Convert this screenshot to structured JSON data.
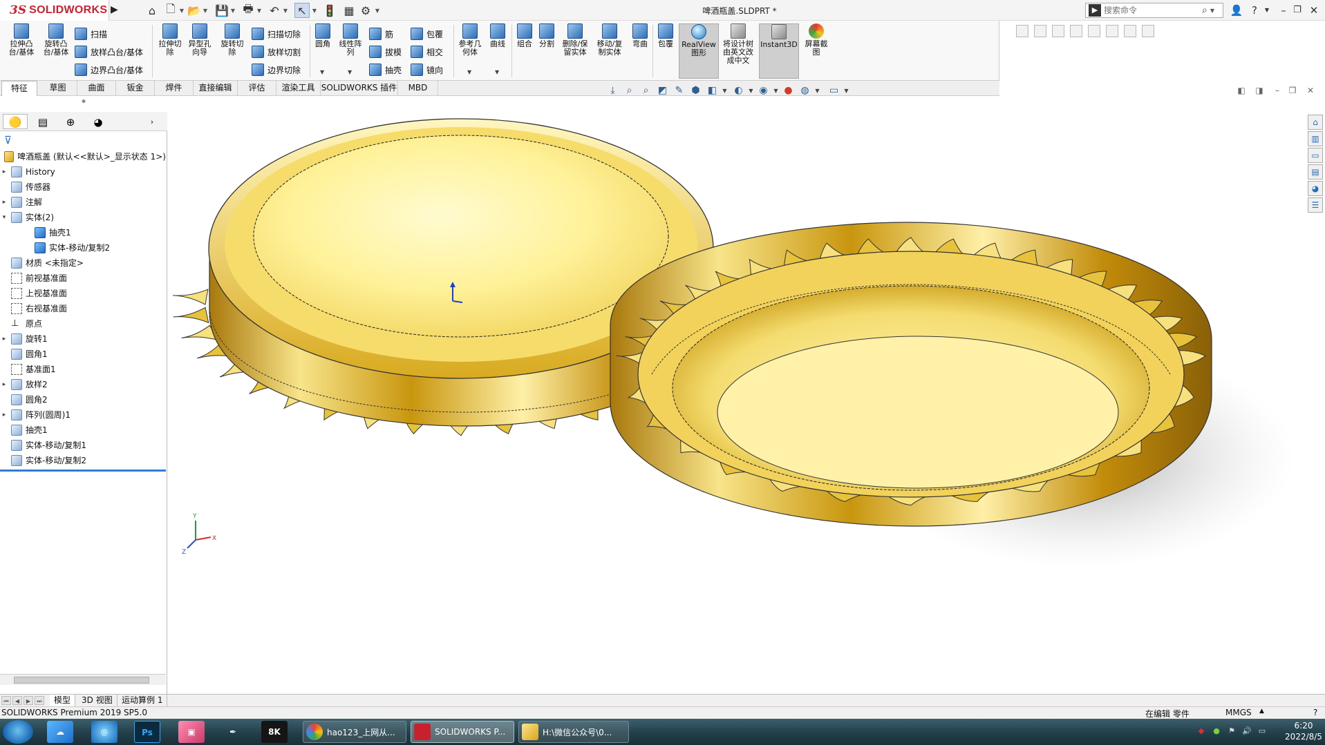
{
  "app": {
    "brand_ds": "3S",
    "brand": "SOLIDWORKS",
    "document_title": "啤酒瓶盖.SLDPRT *",
    "search_placeholder": "搜索命令"
  },
  "quick_access": {
    "icons": [
      "home-icon",
      "new-file-icon",
      "open-icon",
      "save-icon",
      "print-icon",
      "undo-icon",
      "select-icon",
      "traffic-light-icon",
      "file-properties-icon",
      "options-gear-icon"
    ]
  },
  "window": {
    "help": "?"
  },
  "command_manager": {
    "features": {
      "extrude_boss": "拉伸凸台/基体",
      "revolve_boss": "旋转凸台/基体",
      "sweep": "扫描",
      "loft_boss": "放样凸台/基体",
      "boundary_boss": "边界凸台/基体",
      "extrude_cut": "拉伸切除",
      "hole_wizard": "异型孔向导",
      "revolve_cut": "旋转切除",
      "swept_cut": "扫描切除",
      "lofted_cut": "放样切割",
      "boundary_cut": "边界切除",
      "fillet": "圆角",
      "linear_pattern": "线性阵列",
      "rib": "筋",
      "draft": "拔模",
      "shell": "抽壳",
      "wrap": "包覆",
      "intersect": "相交",
      "mirror": "镜向",
      "ref_geometry": "参考几何体",
      "curves": "曲线",
      "combine": "组合",
      "split": "分割",
      "delete_keep_body": "删除/保留实体",
      "move_copy_body": "移动/复制实体",
      "flex": "弯曲",
      "wrap2": "包覆",
      "realview": "RealView图形",
      "translate": "将设计树由英文改成中文",
      "instant3d": "Instant3D",
      "screen_capture": "屏幕截图"
    }
  },
  "tabs": [
    "特征",
    "草图",
    "曲面",
    "钣金",
    "焊件",
    "直接编辑",
    "评估",
    "渲染工具",
    "SOLIDWORKS 插件",
    "MBD"
  ],
  "feature_tree": {
    "root": "啤酒瓶盖  (默认<<默认>_显示状态 1>)",
    "items": [
      {
        "label": "History"
      },
      {
        "label": "传感器"
      },
      {
        "label": "注解"
      },
      {
        "label": "实体(2)"
      },
      {
        "label": "抽壳1"
      },
      {
        "label": "实体-移动/复制2"
      },
      {
        "label": "材质 <未指定>"
      },
      {
        "label": "前视基准面"
      },
      {
        "label": "上视基准面"
      },
      {
        "label": "右视基准面"
      },
      {
        "label": "原点"
      },
      {
        "label": "旋转1"
      },
      {
        "label": "圆角1"
      },
      {
        "label": "基准面1"
      },
      {
        "label": "放样2"
      },
      {
        "label": "圆角2"
      },
      {
        "label": "阵列(圆周)1"
      },
      {
        "label": "抽壳1"
      },
      {
        "label": "实体-移动/复制1"
      },
      {
        "label": "实体-移动/复制2"
      }
    ]
  },
  "model_tabs": [
    "模型",
    "3D 视图",
    "运动算例 1"
  ],
  "status": {
    "product": "SOLIDWORKS Premium 2019 SP5.0",
    "editing": "在编辑 零件",
    "units": "MMGS",
    "units_arrow": "▲",
    "help": "?"
  },
  "taskbar": {
    "tasks": [
      {
        "label": "hao123_上网从..."
      },
      {
        "label": "SOLIDWORKS P..."
      },
      {
        "label": "H:\\微信公众号\\0..."
      }
    ],
    "time": "6:20",
    "date": "2022/8/5"
  },
  "colors": {
    "accent_red": "#d0202e",
    "gold_light": "#fff0a0",
    "gold_dark": "#b8860b",
    "taskbar": "#223f4a"
  }
}
